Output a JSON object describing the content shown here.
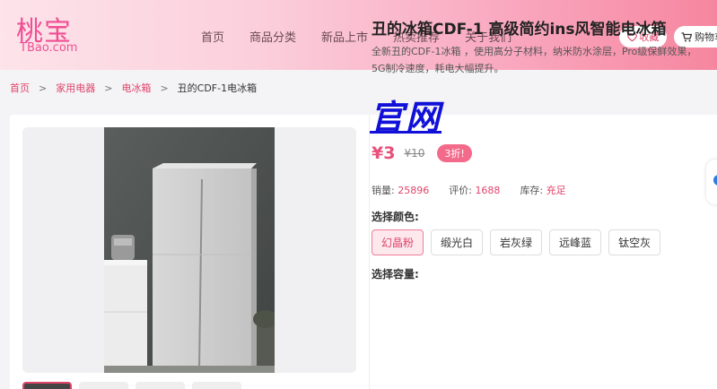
{
  "header": {
    "logo_main": "桃宝",
    "logo_sub": "TBao.com",
    "nav": [
      "首页",
      "商品分类",
      "新品上市",
      "热卖推荐",
      "关于我们"
    ],
    "fav_label": "收藏",
    "cart_label": "购物车"
  },
  "breadcrumb": {
    "items": [
      "首页",
      "家用电器",
      "电冰箱"
    ],
    "current": "丑的CDF-1电冰箱",
    "separator": ">"
  },
  "product": {
    "title": "丑的冰箱CDF-1 高级简约ins风智能电冰箱",
    "description": "全新丑的CDF-1冰箱 ，使用高分子材料，纳米防水涂层，Pro级保鲜效果，5G制冷速度，耗电大幅提升。",
    "official_link": "官网",
    "price": "¥3",
    "original_price": "¥10",
    "discount": "3折!",
    "stats": {
      "sales_label": "销量:",
      "sales_value": "25896",
      "reviews_label": "评价:",
      "reviews_value": "1688",
      "stock_label": "库存:",
      "stock_value": "充足"
    },
    "color_label": "选择颜色:",
    "colors": [
      "幻晶粉",
      "缎光白",
      "岩灰绿",
      "远峰蓝",
      "钛空灰"
    ],
    "selected_color": "幻晶粉",
    "capacity_label": "选择容量:"
  },
  "colors": {
    "accent": "#e0446a",
    "link_blue": "#1010d8",
    "discount_bg": "#f36a8a"
  }
}
